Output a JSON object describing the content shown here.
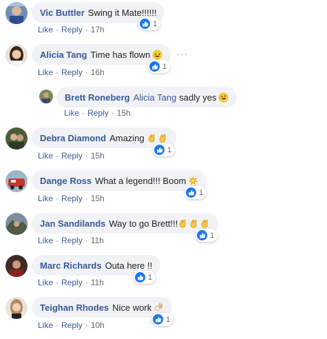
{
  "actions": {
    "like_label": "Like",
    "reply_label": "Reply"
  },
  "comments": [
    {
      "author": "Vic Buttler",
      "text": "Swing it Mate!!!!!!",
      "time": "17h",
      "reactions": "1"
    },
    {
      "author": "Alicia Tang",
      "text": "Time has flown",
      "time": "16h",
      "reactions": "1",
      "more_icon": "ellipsis-icon"
    },
    {
      "author": "Brett Roneberg",
      "mention": "Alicia Tang",
      "text": "sadly yes",
      "time": "15h"
    },
    {
      "author": "Debra Diamond",
      "text": "Amazing",
      "time": "15h",
      "reactions": "1"
    },
    {
      "author": "Dange Ross",
      "text": "What a legend!!! Boom",
      "time": "15h",
      "reactions": "1"
    },
    {
      "author": "Jan Sandilands",
      "text": "Way to go Brett!!!",
      "time": "11h",
      "reactions": "1"
    },
    {
      "author": "Marc Richards",
      "text": "Outa here !!",
      "time": "11h",
      "reactions": "1"
    },
    {
      "author": "Teighan Rhodes",
      "text": "Nice work",
      "time": "10h",
      "reactions": "1"
    }
  ],
  "colors": {
    "link": "#385898",
    "bubble_bg": "#f0f2f5",
    "meta": "#606770",
    "like_blue": "#1877f2"
  },
  "icons": {
    "reaction": "thumbs-up-icon",
    "laugh": "grinning-squinting-face-icon",
    "rofl": "rolling-on-floor-laughing-icon",
    "clap": "clapping-hands-icon",
    "boom": "collision-icon",
    "ok": "ok-hand-icon"
  }
}
